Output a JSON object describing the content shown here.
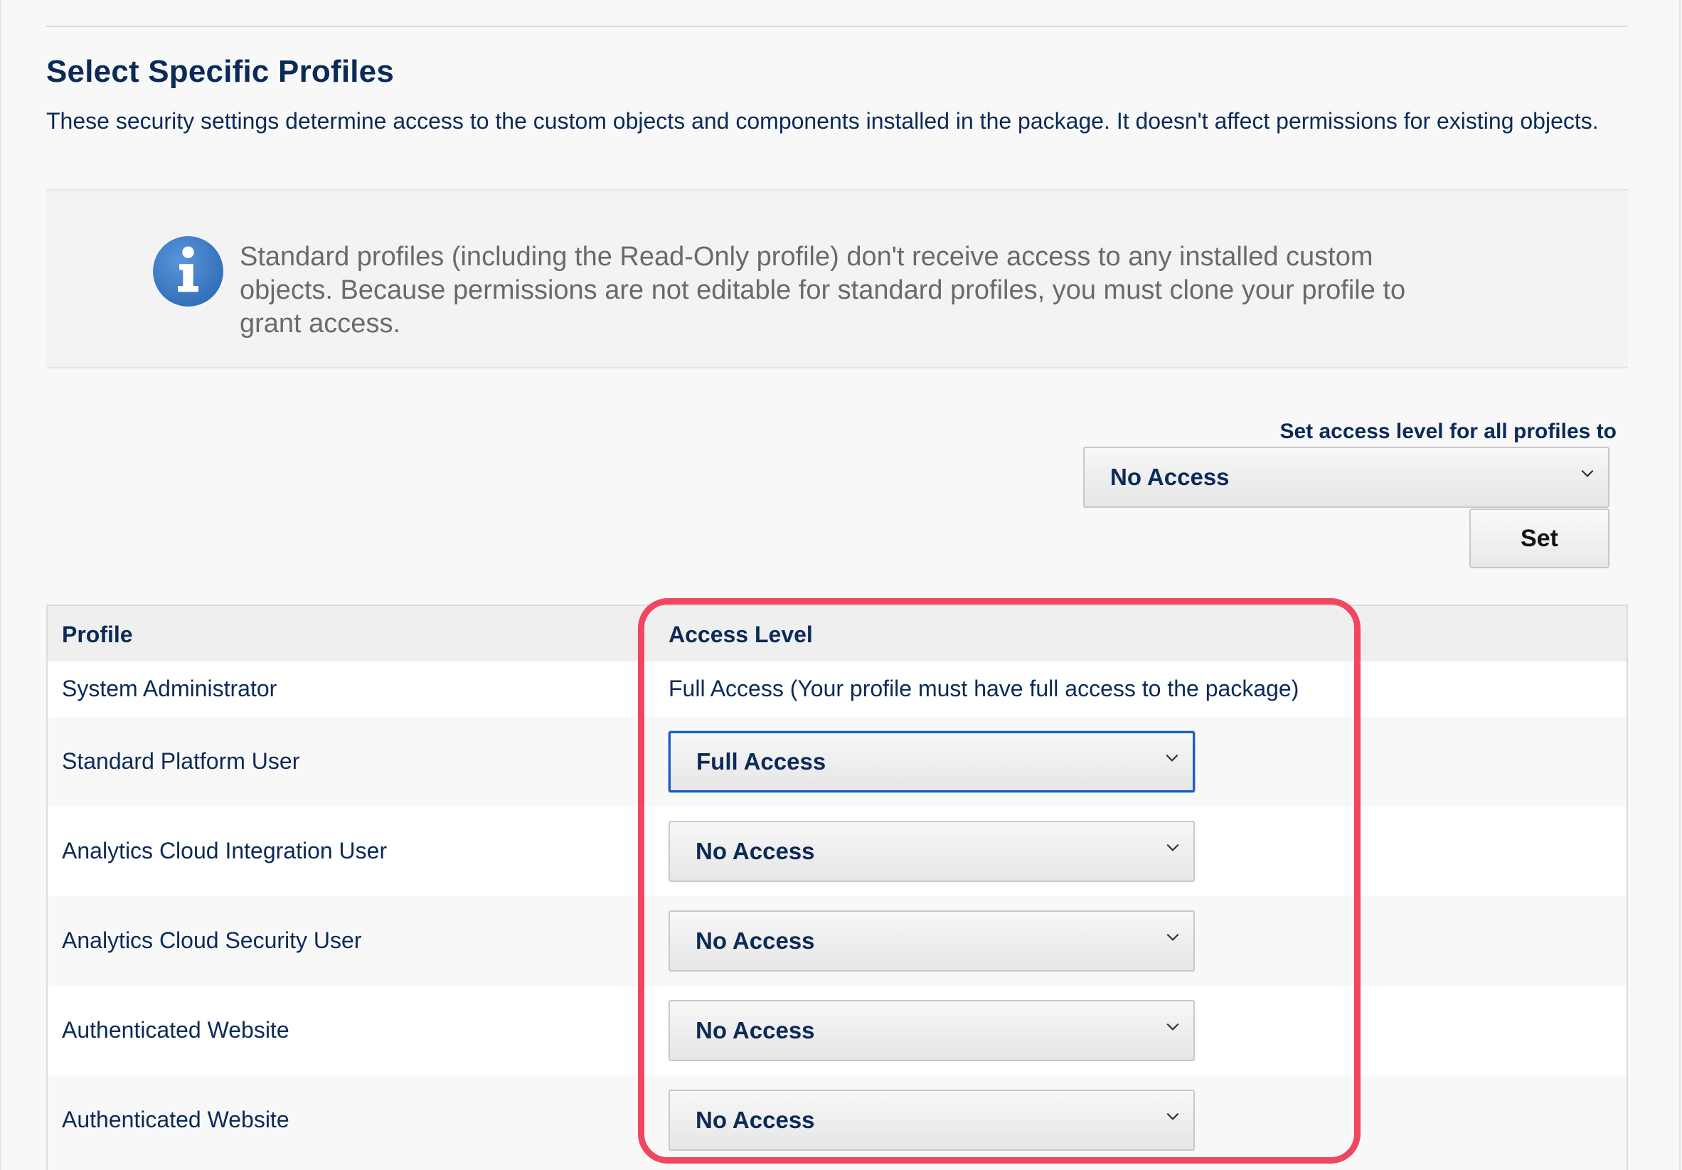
{
  "page": {
    "title": "Select Specific Profiles",
    "description": "These security settings determine access to the custom objects and components installed in the package. It doesn't affect permissions for existing objects."
  },
  "info": {
    "icon": "info-icon",
    "text": "Standard profiles (including the Read-Only profile) don't receive access to any installed custom objects. Because permissions are not editable for standard profiles, you must clone your profile to grant access."
  },
  "bulk": {
    "label": "Set access level for all profiles to",
    "selected": "No Access",
    "set_label": "Set"
  },
  "table": {
    "headers": {
      "profile": "Profile",
      "access": "Access Level"
    },
    "rows": [
      {
        "profile": "System Administrator",
        "access": "Full Access (Your profile must have full access to the package)",
        "editable": false
      },
      {
        "profile": "Standard Platform User",
        "access": "Full Access",
        "editable": true,
        "focused": true
      },
      {
        "profile": "Analytics Cloud Integration User",
        "access": "No Access",
        "editable": true
      },
      {
        "profile": "Analytics Cloud Security User",
        "access": "No Access",
        "editable": true
      },
      {
        "profile": "Authenticated Website",
        "access": "No Access",
        "editable": true
      },
      {
        "profile": "Authenticated Website",
        "access": "No Access",
        "editable": true
      }
    ]
  },
  "colors": {
    "text_navy": "#0b2a57",
    "info_blue": "#3d7cc9",
    "focus_blue": "#1a5fbf",
    "highlight_red": "#f0465f"
  }
}
